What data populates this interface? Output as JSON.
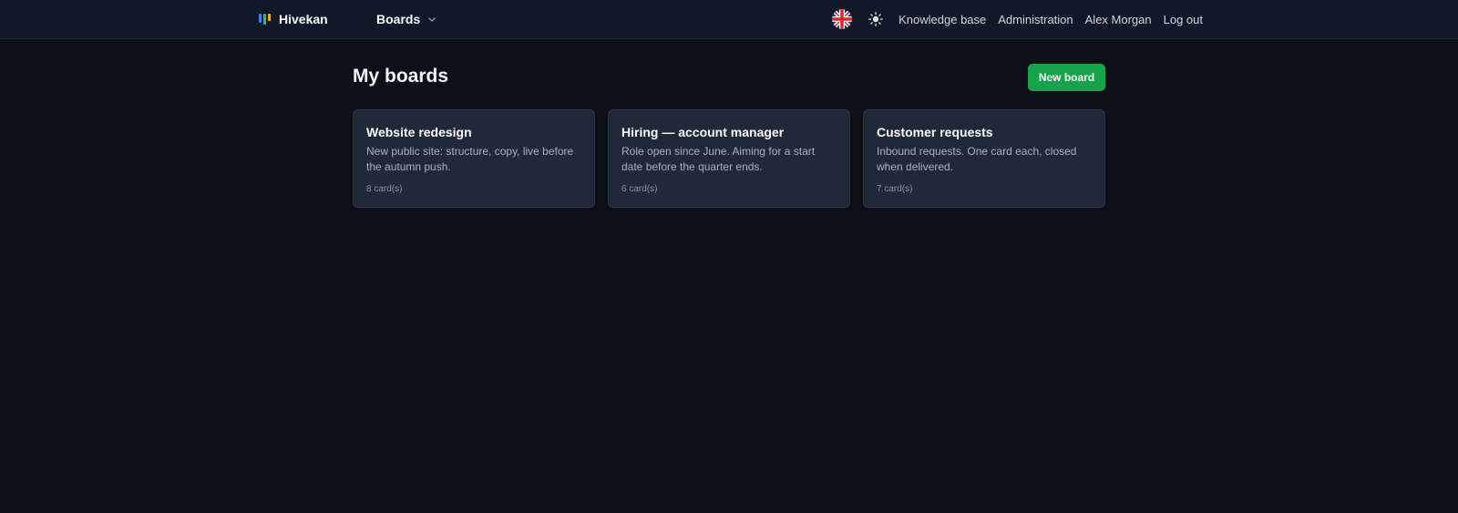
{
  "brand": {
    "name": "Hivekan",
    "logo_colors": [
      "#3b82f6",
      "#22c55e",
      "#eab308"
    ]
  },
  "nav": {
    "boards_label": "Boards",
    "knowledge_base": "Knowledge base",
    "administration": "Administration",
    "user_name": "Alex Morgan",
    "logout": "Log out"
  },
  "main": {
    "title": "My boards",
    "new_board_label": "New board",
    "boards": [
      {
        "title": "Website redesign",
        "description": "New public site: structure, copy, live before the autumn push.",
        "count": "8 card(s)"
      },
      {
        "title": "Hiring — account manager",
        "description": "Role open since June. Aiming for a start date before the quarter ends.",
        "count": "6 card(s)"
      },
      {
        "title": "Customer requests",
        "description": "Inbound requests. One card each, closed when delivered.",
        "count": "7 card(s)"
      }
    ]
  },
  "icons": {
    "language": "uk-flag-icon",
    "theme": "sun-icon",
    "dropdown": "chevron-down-icon"
  },
  "colors": {
    "accent": "#16a34a",
    "background": "#0d1117",
    "topbar": "#111827",
    "card": "#1f2937"
  }
}
